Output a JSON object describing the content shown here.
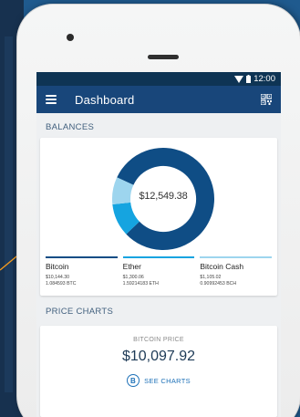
{
  "status_bar": {
    "time": "12:00"
  },
  "app_bar": {
    "title": "Dashboard"
  },
  "balances": {
    "heading": "BALANCES",
    "total": "$12,549.38",
    "coins": [
      {
        "name": "Bitcoin",
        "usd": "$10,144.30",
        "amount": "1.084593 BTC",
        "color": "#0f4d85"
      },
      {
        "name": "Ether",
        "usd": "$1,300.06",
        "amount": "1.59214183 ETH",
        "color": "#15a4e0"
      },
      {
        "name": "Bitcoin Cash",
        "usd": "$1,105.02",
        "amount": "0.90992453 BCH",
        "color": "#9dd5ee"
      }
    ],
    "share": {
      "bitcoin": 10144.3,
      "ether": 1300.06,
      "bitcoin_cash": 1105.02
    }
  },
  "price_charts": {
    "heading": "PRICE CHARTS",
    "title": "BITCOIN PRICE",
    "price": "$10,097.92",
    "badge": "B",
    "link_label": "SEE CHARTS"
  },
  "colors": {
    "app_bar": "#18467a",
    "status_bar": "#0e3454",
    "accent": "#1e71b8"
  }
}
